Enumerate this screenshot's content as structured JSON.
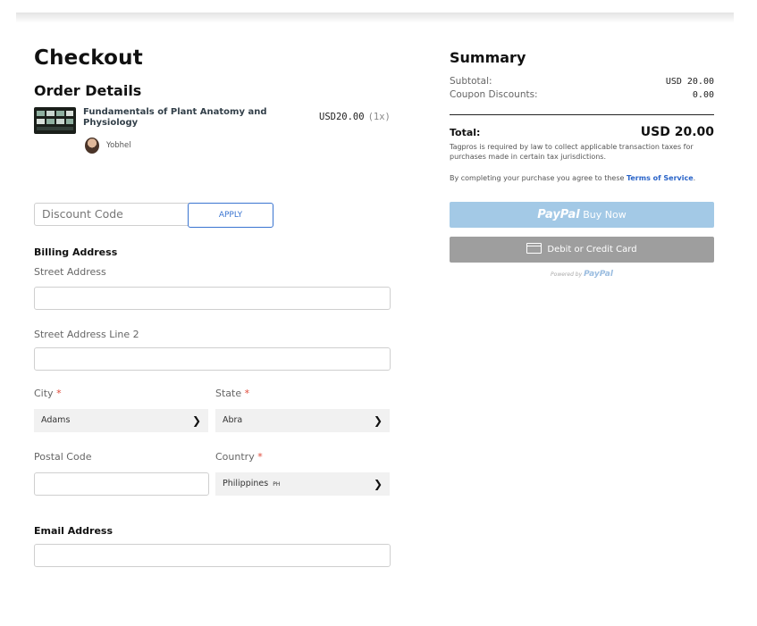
{
  "page": {
    "title": "Checkout"
  },
  "order": {
    "heading": "Order Details",
    "item": {
      "title": "Fundamentals of Plant Anatomy and Physiology",
      "price": "USD20.00",
      "quantity": "(1x)",
      "author": "Yobhel"
    }
  },
  "discount": {
    "placeholder": "Discount Code",
    "apply_label": "APPLY"
  },
  "billing": {
    "heading": "Billing Address",
    "street_label": "Street Address",
    "street_value": "",
    "street2_label": "Street Address Line 2",
    "street2_value": "",
    "city_label": "City",
    "city_value": "Adams",
    "state_label": "State",
    "state_value": "Abra",
    "postal_label": "Postal Code",
    "postal_value": "",
    "country_label": "Country",
    "country_value": "Philippines",
    "country_code": "PH",
    "required_mark": "*"
  },
  "email": {
    "heading": "Email Address",
    "value": ""
  },
  "summary": {
    "heading": "Summary",
    "subtotal_label": "Subtotal:",
    "subtotal_value": "USD 20.00",
    "coupon_label": "Coupon Discounts:",
    "coupon_value": "0.00",
    "total_label": "Total:",
    "total_value": "USD 20.00",
    "tax_note": "Tagpros is required by law to collect applicable transaction taxes for purchases made in certain tax jurisdictions.",
    "terms_prefix": "By completing your purchase you agree to these ",
    "terms_link": "Terms of Service",
    "terms_suffix": "."
  },
  "payment": {
    "paypal_brand": "PayPal",
    "paypal_label": "Buy Now",
    "card_label": "Debit or Credit Card",
    "powered_by": "Powered by",
    "powered_brand": "PayPal"
  },
  "colors": {
    "accent": "#3a74d0",
    "paypal_button": "#a3c9e6",
    "card_button": "#9e9e9e",
    "required": "#e04a3a"
  }
}
